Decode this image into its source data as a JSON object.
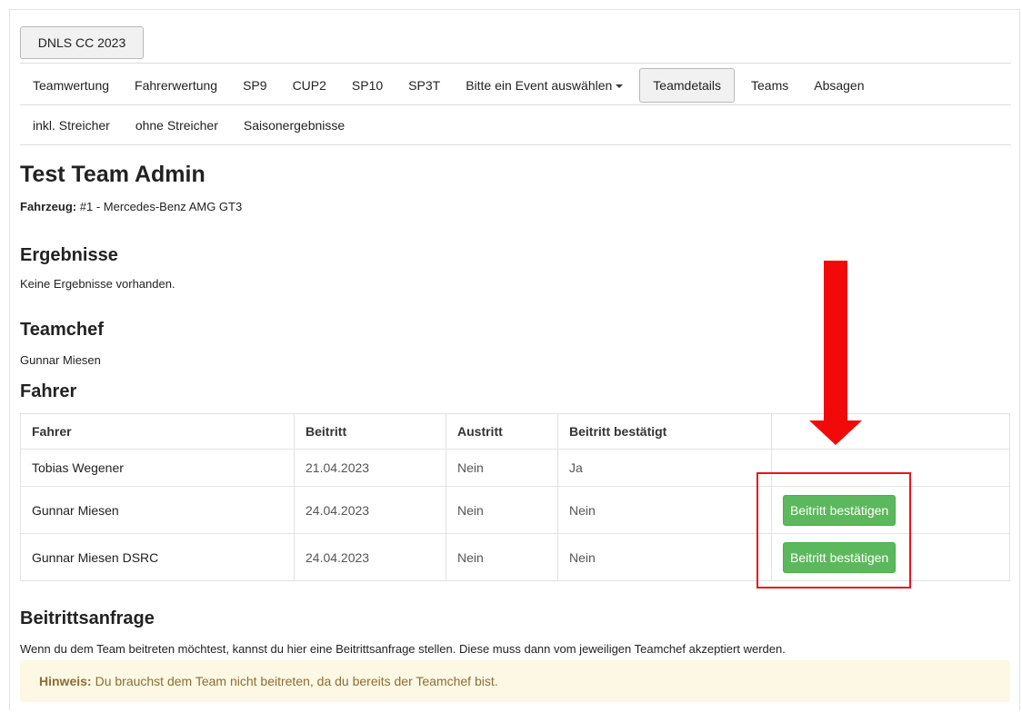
{
  "series_button": "DNLS CC 2023",
  "nav_main": [
    "Teamwertung",
    "Fahrerwertung",
    "SP9",
    "CUP2",
    "SP10",
    "SP3T"
  ],
  "nav_event_dropdown": "Bitte ein Event auswählen",
  "nav_active": "Teamdetails",
  "nav_after": [
    "Teams",
    "Absagen"
  ],
  "nav_sub": [
    "inkl. Streicher",
    "ohne Streicher",
    "Saisonergebnisse"
  ],
  "team": {
    "name": "Test Team Admin",
    "vehicle_label": "Fahrzeug:",
    "vehicle_value": "#1 - Mercedes-Benz AMG GT3"
  },
  "results": {
    "heading": "Ergebnisse",
    "empty_text": "Keine Ergebnisse vorhanden."
  },
  "teamchef": {
    "heading": "Teamchef",
    "name": "Gunnar Miesen"
  },
  "drivers": {
    "heading": "Fahrer",
    "columns": [
      "Fahrer",
      "Beitritt",
      "Austritt",
      "Beitritt bestätigt"
    ],
    "rows": [
      {
        "name": "Tobias Wegener",
        "joined": "21.04.2023",
        "left": "Nein",
        "confirmed": "Ja",
        "action": ""
      },
      {
        "name": "Gunnar Miesen",
        "joined": "24.04.2023",
        "left": "Nein",
        "confirmed": "Nein",
        "action": "Beitritt bestätigen"
      },
      {
        "name": "Gunnar Miesen DSRC",
        "joined": "24.04.2023",
        "left": "Nein",
        "confirmed": "Nein",
        "action": "Beitritt bestätigen"
      }
    ]
  },
  "join_request": {
    "heading": "Beitrittsanfrage",
    "text": "Wenn du dem Team beitreten möchtest, kannst du hier eine Beitrittsanfrage stellen. Diese muss dann vom jeweiligen Teamchef akzeptiert werden.",
    "hint_label": "Hinweis:",
    "hint_text": "Du brauchst dem Team nicht beitreten, da du bereits der Teamchef bist."
  },
  "colors": {
    "confirm_button": "#5cb85c",
    "annotation": "#f20a0a",
    "hint_bg": "#fcf8e3"
  },
  "icons": {
    "dropdown": "caret-down-icon",
    "annotation_arrow": "arrow-down-icon"
  }
}
